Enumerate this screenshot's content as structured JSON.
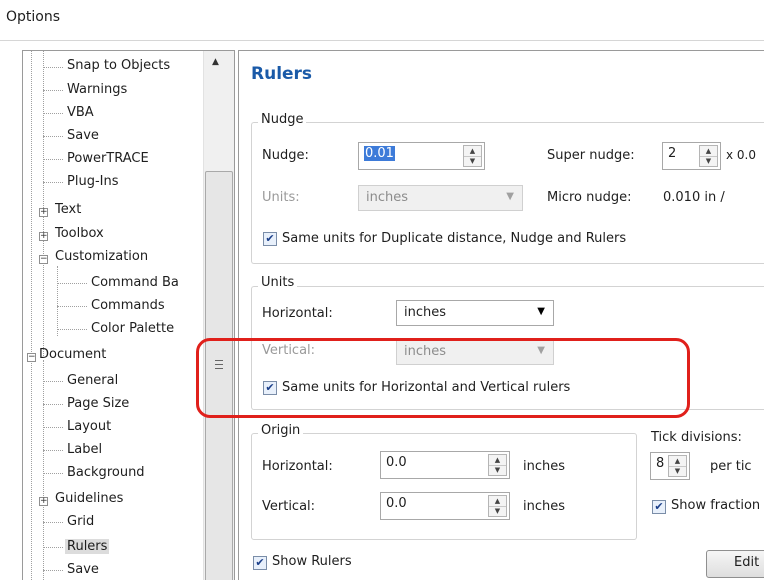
{
  "window": {
    "title": "Options"
  },
  "tree": {
    "items": [
      {
        "label": "Snap to Objects"
      },
      {
        "label": "Warnings"
      },
      {
        "label": "VBA"
      },
      {
        "label": "Save"
      },
      {
        "label": "PowerTRACE"
      },
      {
        "label": "Plug-Ins"
      },
      {
        "label": "Text"
      },
      {
        "label": "Toolbox"
      },
      {
        "label": "Customization"
      },
      {
        "label": "Command Ba"
      },
      {
        "label": "Commands"
      },
      {
        "label": "Color Palette"
      },
      {
        "label": "Document"
      },
      {
        "label": "General"
      },
      {
        "label": "Page Size"
      },
      {
        "label": "Layout"
      },
      {
        "label": "Label"
      },
      {
        "label": "Background"
      },
      {
        "label": "Guidelines"
      },
      {
        "label": "Grid"
      },
      {
        "label": "Rulers"
      },
      {
        "label": "Save"
      }
    ]
  },
  "rulers": {
    "heading": "Rulers",
    "nudge_group": {
      "title": "Nudge",
      "nudge_label": "Nudge:",
      "nudge_value": "0.01",
      "super_nudge_label": "Super nudge:",
      "super_nudge_value": "2",
      "super_nudge_suffix": "x 0.0",
      "units_label": "Units:",
      "units_value": "inches",
      "micro_nudge_label": "Micro nudge:",
      "micro_nudge_value": "0.010 in /",
      "same_units_label": "Same units for Duplicate distance, Nudge and Rulers",
      "same_units_checked": true
    },
    "units_group": {
      "title": "Units",
      "horizontal_label": "Horizontal:",
      "horizontal_value": "inches",
      "vertical_label": "Vertical:",
      "vertical_value": "inches",
      "same_units_label": "Same units for Horizontal and Vertical rulers",
      "same_units_checked": true
    },
    "origin_group": {
      "title": "Origin",
      "horizontal_label": "Horizontal:",
      "horizontal_value": "0.0",
      "horizontal_unit": "inches",
      "vertical_label": "Vertical:",
      "vertical_value": "0.0",
      "vertical_unit": "inches"
    },
    "tick": {
      "title": "Tick divisions:",
      "value": "8",
      "suffix": "per tic",
      "show_fraction_label": "Show fraction",
      "show_fraction_checked": true
    },
    "show_rulers_label": "Show Rulers",
    "show_rulers_checked": true,
    "edit_button_label": "Edit"
  },
  "colors": {
    "heading": "#1a5aa8",
    "annotation": "#e0201b",
    "selection": "#3d7bd9"
  }
}
